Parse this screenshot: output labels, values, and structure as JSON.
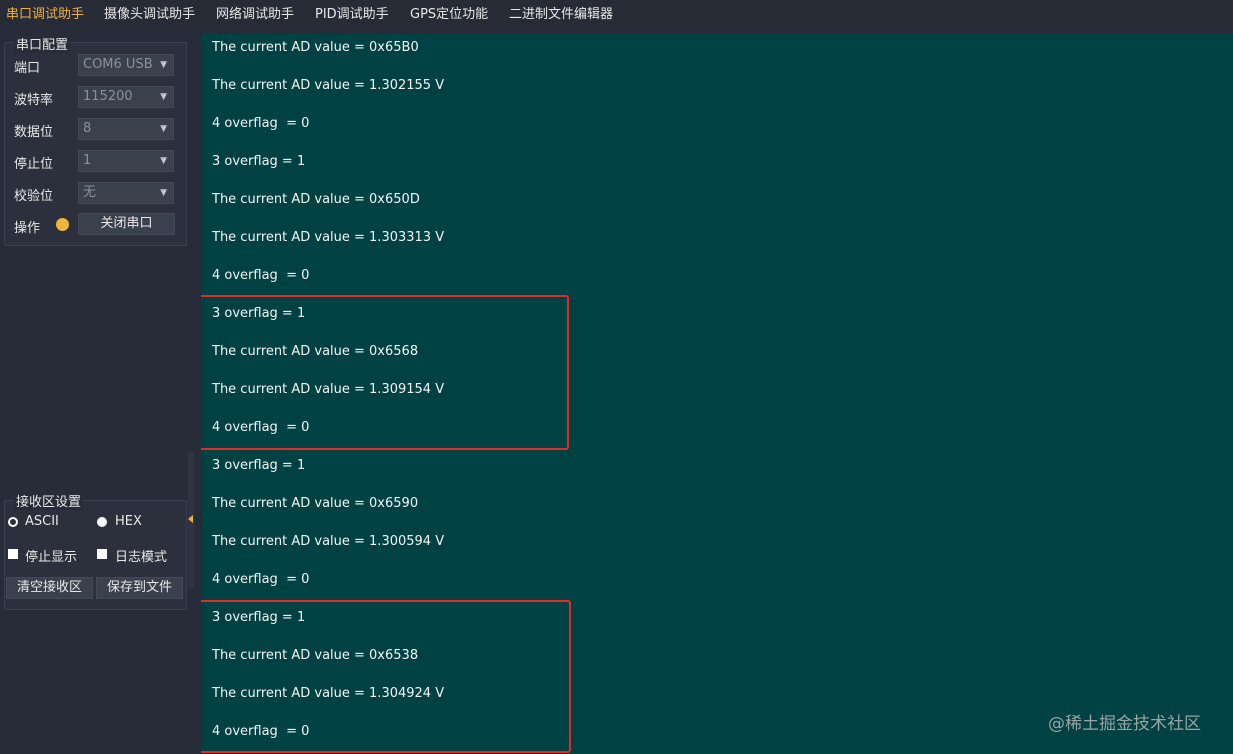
{
  "menu": [
    "串口调试助手",
    "摄像头调试助手",
    "网络调试助手",
    "PID调试助手",
    "GPS定位功能",
    "二进制文件编辑器"
  ],
  "serial_config": {
    "title": "串口配置",
    "port_label": "端口",
    "port_value": "COM6 USB",
    "baud_label": "波特率",
    "baud_value": "115200",
    "databits_label": "数据位",
    "databits_value": "8",
    "stopbits_label": "停止位",
    "stopbits_value": "1",
    "parity_label": "校验位",
    "parity_value": "无",
    "op_label": "操作",
    "close_button": "关闭串口",
    "status_color": "#f0b43c"
  },
  "recv_settings": {
    "title": "接收区设置",
    "ascii_label": "ASCII",
    "hex_label": "HEX",
    "ascii_selected": false,
    "hex_selected": true,
    "stop_display_label": "停止显示",
    "log_mode_label": "日志模式",
    "clear_button": "清空接收区",
    "save_button": "保存到文件"
  },
  "receive_lines": [
    "The current AD value = 0x65B0",
    "The current AD value = 1.302155 V",
    "4 overflag  = 0",
    "3 overflag = 1",
    "The current AD value = 0x650D",
    "The current AD value = 1.303313 V",
    "4 overflag  = 0",
    "3 overflag = 1",
    "The current AD value = 0x6568",
    "The current AD value = 1.309154 V",
    "4 overflag  = 0",
    "3 overflag = 1",
    "The current AD value = 0x6590",
    "The current AD value = 1.300594 V",
    "4 overflag  = 0",
    "3 overflag = 1",
    "The current AD value = 0x6538",
    "The current AD value = 1.304924 V",
    "4 overflag  = 0"
  ],
  "colors": {
    "receive_bg": "#004143",
    "highlight": "#e02c22",
    "active_tab": "#f0b03a"
  },
  "watermark": "@稀土掘金技术社区"
}
